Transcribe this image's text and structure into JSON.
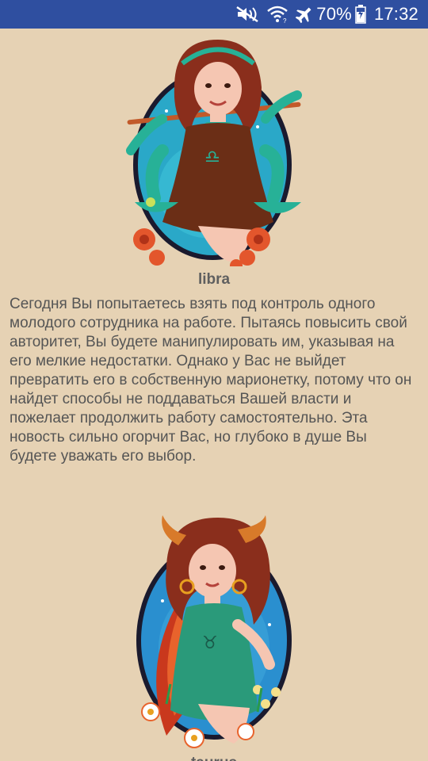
{
  "status_bar": {
    "battery": "70%",
    "time": "17:32",
    "icons": [
      "mute-icon",
      "wifi-icon",
      "airplane-icon",
      "battery-icon"
    ]
  },
  "colors": {
    "background": "#e6d2b4",
    "status_bar": "#2f4fa0",
    "text": "#555555",
    "title": "#5f5f5f"
  },
  "cards": [
    {
      "title": "libra",
      "image_icon": "libra-zodiac-illustration",
      "text": "Сегодня Вы попытаетесь взять под контроль одного молодого сотрудника на работе. Пытаясь повысить свой авторитет, Вы будете манипулировать им, указывая на его мелкие недостатки. Однако у Вас не выйдет превратить его в собственную марионетку, потому что он найдет способы не поддаваться Вашей власти и пожелает продолжить работу самостоятельно. Эта новость сильно огорчит Вас, но глубоко в душе Вы будете уважать его выбор."
    },
    {
      "title": "taurus",
      "image_icon": "taurus-zodiac-illustration"
    }
  ]
}
